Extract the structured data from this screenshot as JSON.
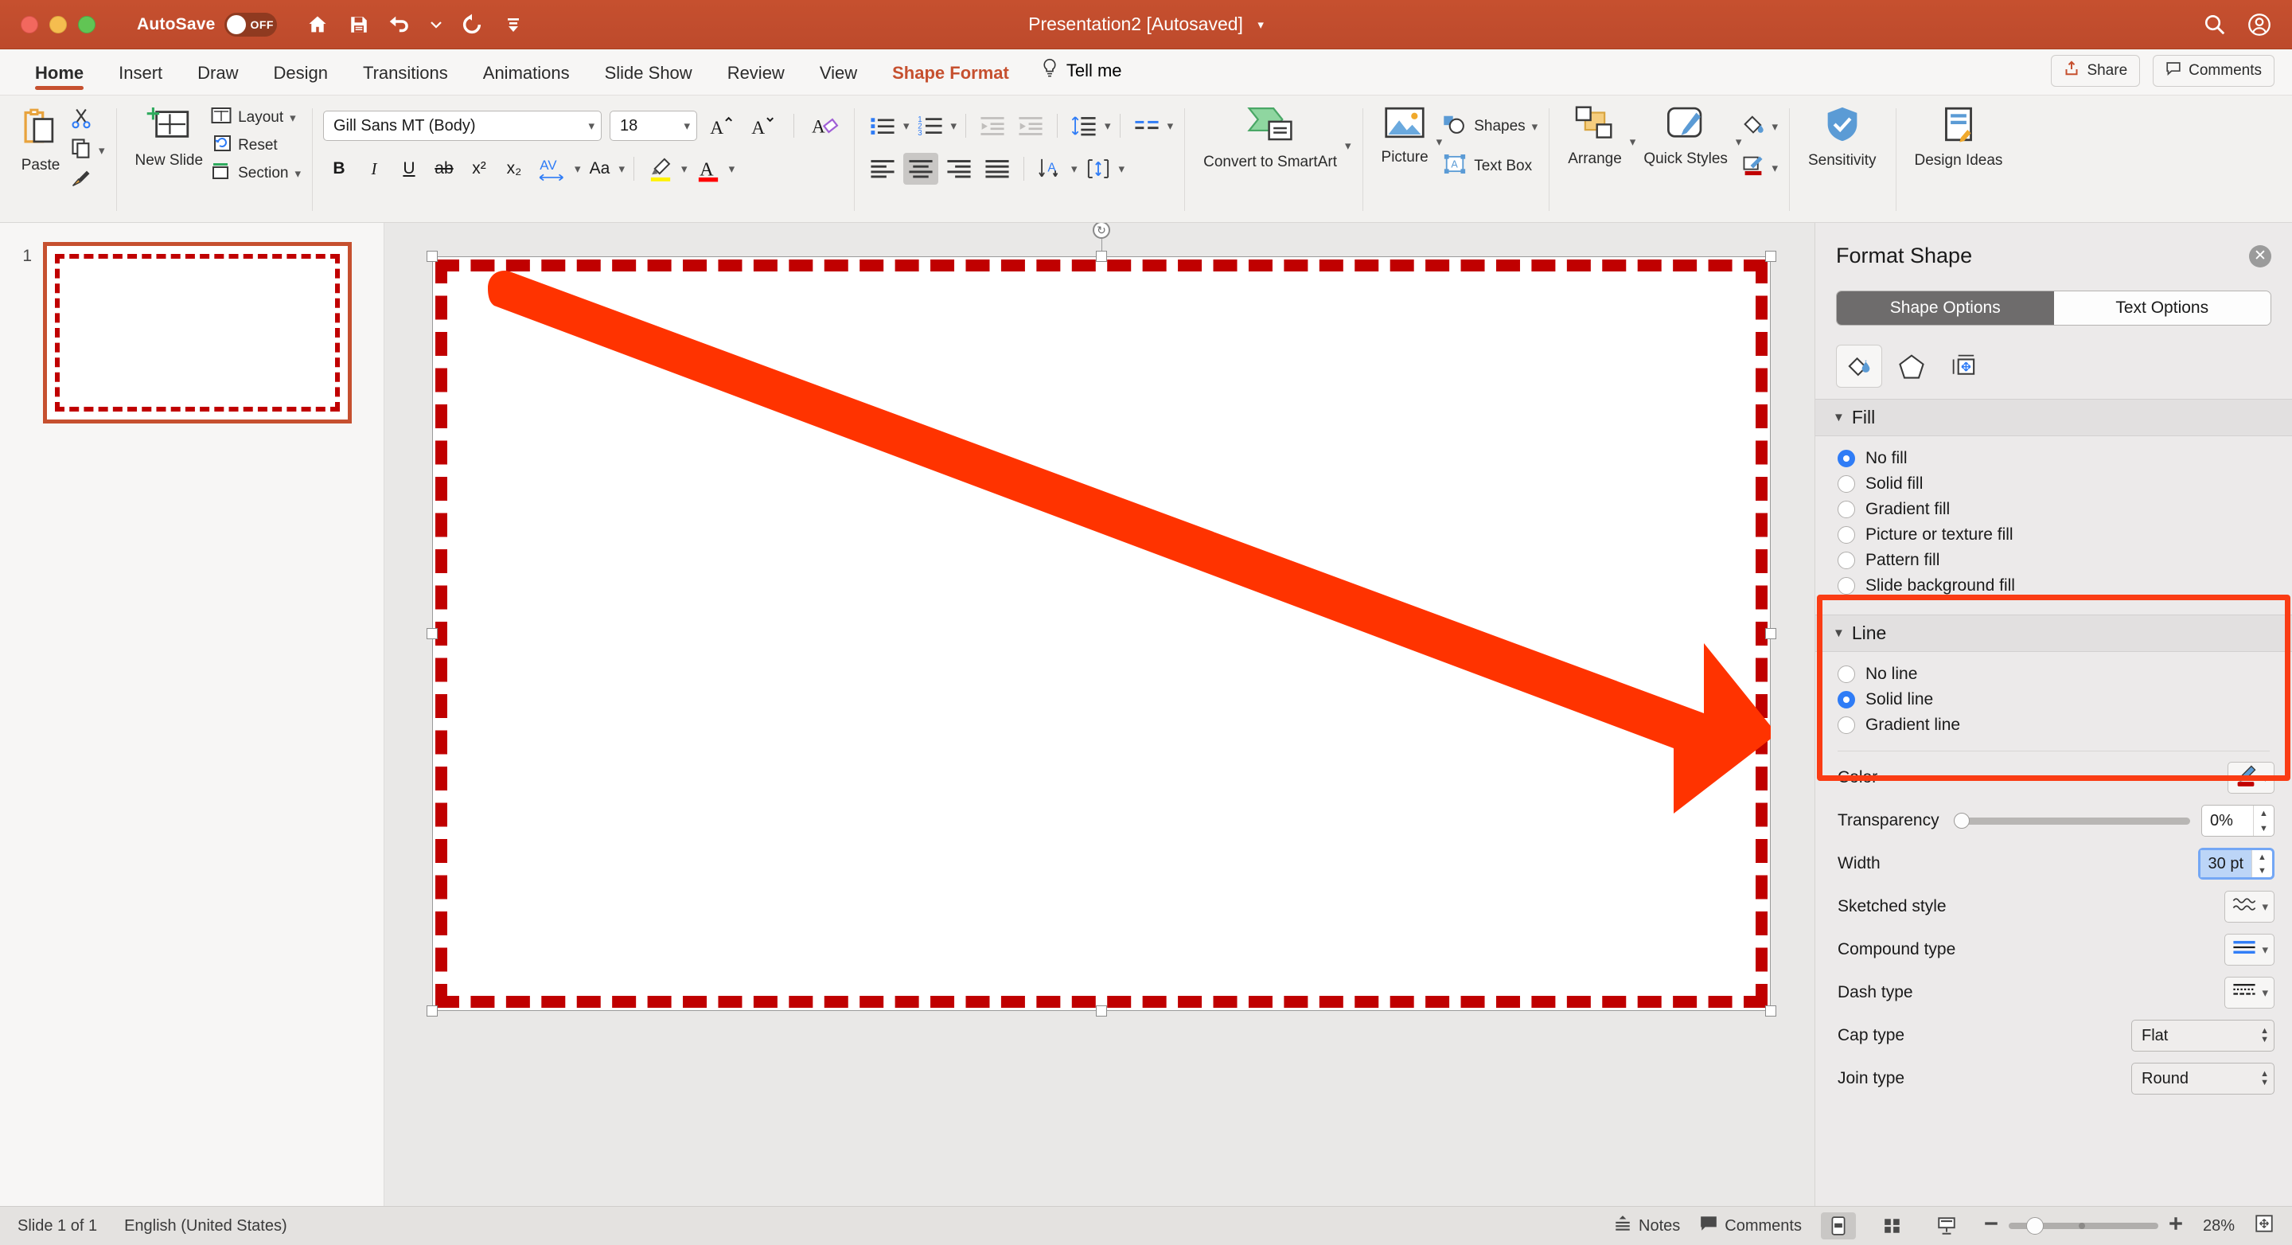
{
  "titlebar": {
    "autosave_label": "AutoSave",
    "autosave_state": "OFF",
    "window_title": "Presentation2 [Autosaved]",
    "icons": [
      "home-icon",
      "save-icon",
      "undo-icon",
      "redo-icon",
      "customize-toolbar-icon"
    ],
    "right_icons": [
      "search-icon",
      "account-icon"
    ]
  },
  "tabs": [
    {
      "label": "Home",
      "active": true
    },
    {
      "label": "Insert",
      "active": false
    },
    {
      "label": "Draw",
      "active": false
    },
    {
      "label": "Design",
      "active": false
    },
    {
      "label": "Transitions",
      "active": false
    },
    {
      "label": "Animations",
      "active": false
    },
    {
      "label": "Slide Show",
      "active": false
    },
    {
      "label": "Review",
      "active": false
    },
    {
      "label": "View",
      "active": false
    },
    {
      "label": "Shape Format",
      "active": false,
      "contextual": true
    }
  ],
  "tellme": "Tell me",
  "ribbon_right": {
    "share": "Share",
    "comments": "Comments"
  },
  "ribbon": {
    "clipboard": {
      "paste_label": "Paste",
      "cut_icon": "scissors-icon",
      "copy_icon": "copy-icon",
      "format_painter_icon": "format-painter-icon"
    },
    "slides": {
      "new_slide_label": "New Slide",
      "layout_label": "Layout",
      "reset_label": "Reset",
      "section_label": "Section"
    },
    "font": {
      "font_name": "Gill Sans MT (Body)",
      "font_size": "18",
      "grow_icon": "increase-font-size-icon",
      "shrink_icon": "decrease-font-size-icon",
      "clear_formatting_icon": "clear-formatting-icon",
      "bold": "B",
      "italic": "I",
      "underline": "U",
      "strikethrough": "ab",
      "superscript": "x²",
      "subscript": "x₂",
      "char_spacing": "AV",
      "change_case": "Aa",
      "highlight_icon": "text-highlight-icon",
      "font_color_icon": "font-color-icon",
      "highlight_color": "#FFF200",
      "font_color": "#FF0000"
    },
    "paragraph": {
      "bullets_icon": "bullets-icon",
      "numbering_icon": "numbering-icon",
      "decrease_indent_icon": "decrease-indent-icon",
      "increase_indent_icon": "increase-indent-icon",
      "line_spacing_icon": "line-spacing-icon",
      "columns_icon": "columns-icon",
      "align_left_icon": "align-left-icon",
      "align_center_icon": "align-center-icon",
      "align_right_icon": "align-right-icon",
      "justify_icon": "justify-icon",
      "text_direction_icon": "text-direction-icon",
      "align_text_icon": "align-text-icon",
      "active_alignment": "center"
    },
    "smartart": {
      "label": "Convert to SmartArt"
    },
    "insert": {
      "picture_label": "Picture",
      "shapes_label": "Shapes",
      "textbox_label": "Text Box"
    },
    "drawing": {
      "arrange_label": "Arrange",
      "quick_styles_label": "Quick Styles",
      "shape_fill_icon": "shape-fill-icon",
      "shape_outline_icon": "shape-outline-icon",
      "shape_outline_color": "#C00000"
    },
    "sensitivity_label": "Sensitivity",
    "design_ideas_label": "Design Ideas"
  },
  "thumbnails": {
    "slides": [
      {
        "number": "1",
        "border_color": "#C00000",
        "selected": true
      }
    ]
  },
  "canvas": {
    "shape": {
      "name": "sketched-rectangle",
      "outline_color": "#C00000",
      "fill": "none",
      "selected": true
    },
    "arrow": {
      "name": "red-arrow-annotation",
      "color": "#FF3300"
    },
    "rotate_handle_icon": "rotate-handle-icon"
  },
  "panel": {
    "title": "Format Shape",
    "close_icon": "close-icon",
    "tabs": [
      {
        "label": "Shape Options",
        "active": true
      },
      {
        "label": "Text Options",
        "active": false
      }
    ],
    "icon_tabs": [
      {
        "name": "fill-and-line-icon",
        "active": true
      },
      {
        "name": "effects-icon",
        "active": false
      },
      {
        "name": "size-and-properties-icon",
        "active": false
      }
    ],
    "fill": {
      "section_title": "Fill",
      "expanded": true,
      "options": [
        {
          "label": "No fill",
          "selected": true
        },
        {
          "label": "Solid fill",
          "selected": false
        },
        {
          "label": "Gradient fill",
          "selected": false
        },
        {
          "label": "Picture or texture fill",
          "selected": false
        },
        {
          "label": "Pattern fill",
          "selected": false
        },
        {
          "label": "Slide background fill",
          "selected": false
        }
      ]
    },
    "line": {
      "section_title": "Line",
      "expanded": true,
      "highlighted": true,
      "highlight_color": "#FA3C14",
      "options": [
        {
          "label": "No line",
          "selected": false
        },
        {
          "label": "Solid line",
          "selected": true
        },
        {
          "label": "Gradient line",
          "selected": false
        }
      ],
      "color_label": "Color",
      "color_value": "#C00000",
      "color_icon": "line-color-pen-icon",
      "transparency_label": "Transparency",
      "transparency_value": "0%",
      "width_label": "Width",
      "width_value": "30 pt",
      "width_focused": true,
      "sketched_style_label": "Sketched style",
      "sketched_style_icon": "sketched-style-icon",
      "compound_type_label": "Compound type",
      "compound_type_icon": "compound-type-icon",
      "dash_type_label": "Dash type",
      "dash_type_icon": "dash-type-icon",
      "cap_type_label": "Cap type",
      "cap_type_value": "Flat",
      "join_type_label": "Join type",
      "join_type_value": "Round"
    }
  },
  "status": {
    "slide_counter": "Slide 1 of 1",
    "language": "English (United States)",
    "notes_label": "Notes",
    "comments_label": "Comments",
    "views": [
      {
        "name": "normal-view-button",
        "active": true
      },
      {
        "name": "slide-sorter-view-button",
        "active": false
      },
      {
        "name": "reading-view-button",
        "active": false
      }
    ],
    "zoom_out_icon": "zoom-out-icon",
    "zoom_in_icon": "zoom-in-icon",
    "zoom_value": "28%",
    "fit_slide_icon": "fit-slide-to-window-icon"
  }
}
